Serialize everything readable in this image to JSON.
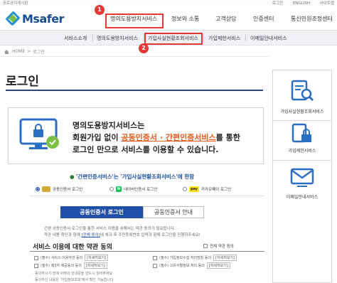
{
  "util": {
    "left": "포토공지게시판",
    "right": [
      "로그인",
      "ENGLISH",
      "사이트맵"
    ]
  },
  "brand": {
    "name": "Msafer",
    "blue": "#2a8fd1",
    "green": "#7bc143",
    "navy": "#1b4d8c"
  },
  "gnb": [
    "명의도용방지서비스",
    "정보와 소통",
    "고객상담",
    "인증센터",
    "통신민원조정센터"
  ],
  "subnav": [
    "서비스소개",
    "명의도용방지서비스",
    "가입사실현황조회서비스",
    "가입제한서비스",
    "이메일안내서비스"
  ],
  "breadcrumb": {
    "home": "HOME",
    "current": "로그인"
  },
  "page_title": "로그인",
  "info": {
    "line1": "명의도용방지서비스는",
    "line2_pre": "회원가입 없이 ",
    "line2_highlight": "공동인증서 · 간편인증서비스",
    "line2_post": "를 통한",
    "line3": "로그인 만으로 서비스를 이용할 수 있습니다."
  },
  "notice": {
    "bullet": "●",
    "quote": "'간편인증서비스'는 '가입사실현황조회서비스'에 한함"
  },
  "login_options": [
    {
      "label": "공동인증서 로그인",
      "selected": true,
      "icon": "certificate-icon"
    },
    {
      "label": "네이버인증서 로그인",
      "selected": false,
      "icon": "naver-icon"
    },
    {
      "label": "카카오페이 로그인",
      "selected": false,
      "icon": "kakaopay-icon"
    }
  ],
  "icon_text": {
    "naver": "N",
    "kakaopay": "pay"
  },
  "tabs": {
    "active": "공동인증서 로그인",
    "inactive": "공동인증서 안내"
  },
  "hints": {
    "line1": "간편 공동인증서 로그인을 통한 서비스 이용을 위해서는 약관 동의가 필요합니다.",
    "line2_pre": "약관 내용 확인과 함께 ",
    "line2_link": "[전체 동의]",
    "line2_post": "에 체크 후 주민등록번호 입력과 함께 로그인을 진행하주세요!"
  },
  "terms": {
    "title": "서비스 이용에 대한 약관 동의",
    "agree_all": "전체 약관 동의",
    "items": [
      {
        "label": "(필수) 서비스 이용약관 동의",
        "view": "[자세히보기]"
      },
      {
        "label": "(필수) 가입정보수집 처리방침 동의",
        "view": "[자세히보기]"
      },
      {
        "label": "(필수) 제3자 제공동의 동의",
        "view": "[자세히보기]"
      },
      {
        "label": "(필수) 고유식별정보 처리 동의",
        "view": "[자세히보기]"
      }
    ],
    "footnotes": [
      "· 동의하시기 전에 아래의 안내문을 반드시 읽어주세요",
      "· 동의하신 내용은 '가입정보조회'에서 확인 가능합니다"
    ]
  },
  "rail": [
    {
      "label": "가입사실현황조회서비스",
      "icon": "search-document-icon"
    },
    {
      "label": "가입제한서비스",
      "icon": "lock-icon"
    },
    {
      "label": "이메일안내서비스",
      "icon": "mail-icon"
    }
  ],
  "annotations": [
    "1",
    "2"
  ],
  "colors": {
    "accent_red": "#e53935",
    "primary_blue": "#1f4fa7",
    "highlight_orange": "#e35a1a",
    "title_line": "#2b4a7a"
  }
}
